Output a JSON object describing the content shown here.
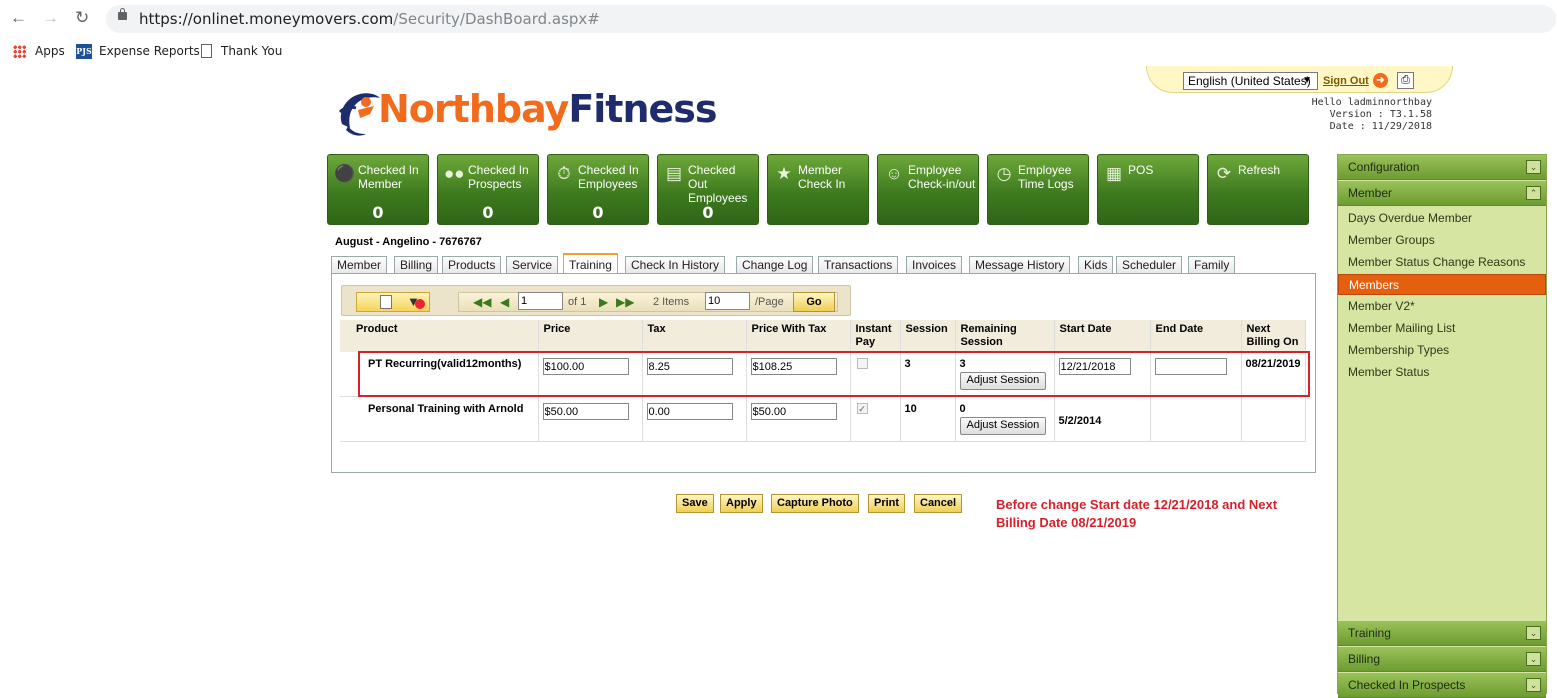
{
  "browser": {
    "url_host": "https://onlinet.moneymovers.com",
    "url_path": "/Security/DashBoard.aspx#",
    "bookmarks": [
      {
        "label": "Apps",
        "icon": "apps-grid-icon"
      },
      {
        "label": "Expense Reports",
        "icon": "pjs-icon",
        "icon_text": "PJS"
      },
      {
        "label": "Thank You",
        "icon": "page-icon"
      }
    ]
  },
  "header": {
    "logo_part1": "Northbay",
    "logo_part2": "Fitness",
    "language": "English (United States)",
    "sign_out": "Sign Out",
    "hello": "Hello ladminnorthbay",
    "version": "Version : T3.1.58",
    "date": "Date : 11/29/2018"
  },
  "tiles": [
    {
      "label": "Checked In Member",
      "count": "0",
      "icon": "person-icon"
    },
    {
      "label": "Checked In Prospects",
      "count": "0",
      "icon": "group-icon"
    },
    {
      "label": "Checked In Employees",
      "count": "0",
      "icon": "stopwatch-icon"
    },
    {
      "label": "Checked Out Employees",
      "count": "0",
      "icon": "register-icon"
    },
    {
      "label": "Member Check In",
      "count": "",
      "icon": "star-icon"
    },
    {
      "label": "Employee Check-in/out",
      "count": "",
      "icon": "smiley-icon"
    },
    {
      "label": "Employee Time Logs",
      "count": "",
      "icon": "clock-icon"
    },
    {
      "label": "POS",
      "count": "",
      "icon": "pos-terminal-icon"
    },
    {
      "label": "Refresh",
      "count": "",
      "icon": "refresh-icon"
    }
  ],
  "member": {
    "name_line": "August - Angelino - 7676767"
  },
  "tabs": [
    "Member",
    "Billing",
    "Products",
    "Service",
    "Training",
    "Check In History",
    "Change Log",
    "Transactions",
    "Invoices",
    "Message History",
    "Kids",
    "Scheduler",
    "Family"
  ],
  "active_tab": "Training",
  "toolbar": {
    "page_value": "1",
    "of_text": "of 1",
    "items_text": "2 Items",
    "per_page_value": "10",
    "per_page_label": "/Page",
    "go_label": "Go"
  },
  "table": {
    "headers": [
      "Product",
      "Price",
      "Tax",
      "Price With Tax",
      "Instant Pay",
      "Session",
      "Remaining Session",
      "Start Date",
      "End Date",
      "Next Billing On"
    ],
    "rows": [
      {
        "product": "PT Recurring(valid12months)",
        "price": "$100.00",
        "tax": "8.25",
        "price_with_tax": "$108.25",
        "instant_pay": false,
        "session": "3",
        "remaining": "3",
        "adjust_label": "Adjust Session",
        "start_date": "12/21/2018",
        "end_date": "",
        "next_billing": "08/21/2019"
      },
      {
        "product": "Personal Training with Arnold",
        "price": "$50.00",
        "tax": "0.00",
        "price_with_tax": "$50.00",
        "instant_pay": true,
        "session": "10",
        "remaining": "0",
        "adjust_label": "Adjust Session",
        "start_date": "5/2/2014",
        "end_date": "",
        "next_billing": ""
      }
    ]
  },
  "buttons": {
    "save": "Save",
    "apply": "Apply",
    "capture": "Capture Photo",
    "print": "Print",
    "cancel": "Cancel"
  },
  "annotation": {
    "line1": "Before change Start date 12/21/2018 and Next",
    "line2": "Billing Date 08/21/2019"
  },
  "sidebar": {
    "sections_top": [
      "Configuration",
      "Member"
    ],
    "member_items": [
      "Days Overdue Member",
      "Member Groups",
      "Member Status Change Reasons",
      "Members",
      "Member V2*",
      "Member Mailing List",
      "Membership Types",
      "Member Status"
    ],
    "selected_item": "Members",
    "sections_bottom": [
      "Training",
      "Billing",
      "Checked In Prospects"
    ]
  },
  "colors": {
    "tile_green": "#3e7b1f",
    "sidebar_green": "#d7e5a3",
    "selected_orange": "#e4600f",
    "annotation_red": "#d8202a",
    "logo_orange": "#f26a1b",
    "logo_navy": "#1f2c6b"
  }
}
